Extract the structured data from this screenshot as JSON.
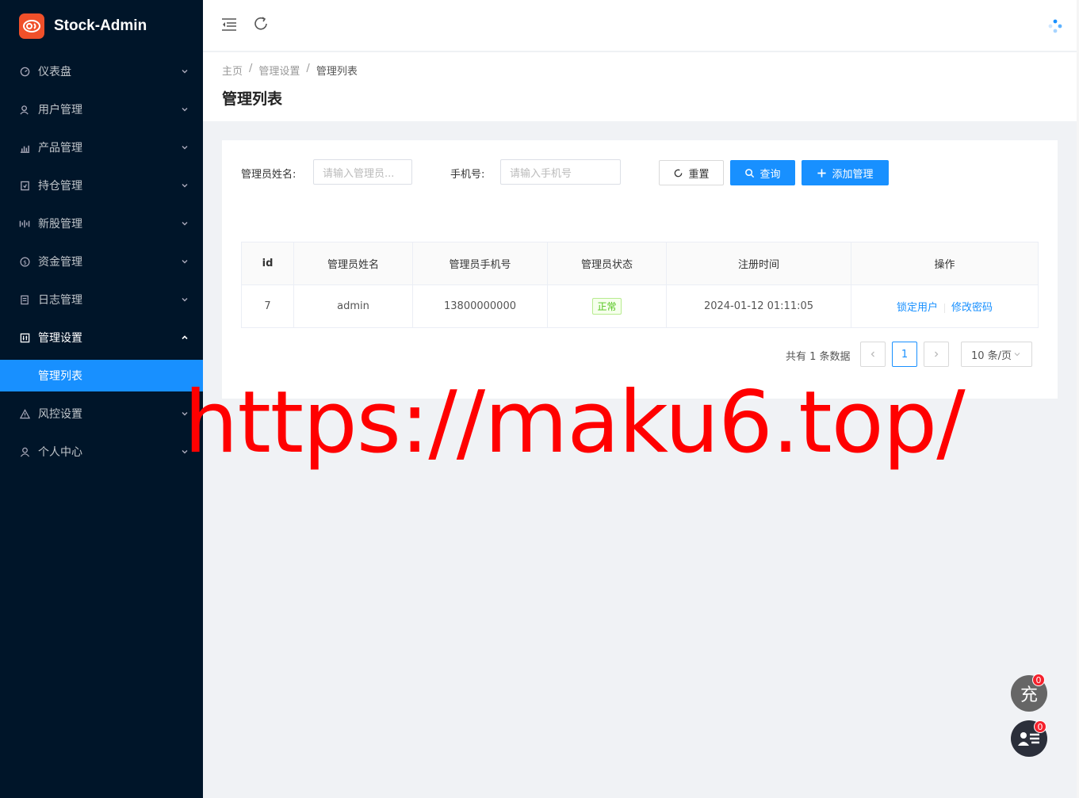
{
  "app": {
    "title": "Stock-Admin"
  },
  "sidebar": {
    "items": [
      {
        "label": "仪表盘",
        "icon": "dashboard-icon"
      },
      {
        "label": "用户管理",
        "icon": "users-icon"
      },
      {
        "label": "产品管理",
        "icon": "chart-icon"
      },
      {
        "label": "持仓管理",
        "icon": "holding-icon"
      },
      {
        "label": "新股管理",
        "icon": "ipo-icon"
      },
      {
        "label": "资金管理",
        "icon": "dollar-icon"
      },
      {
        "label": "日志管理",
        "icon": "log-icon"
      },
      {
        "label": "管理设置",
        "icon": "settings-icon"
      },
      {
        "label": "风控设置",
        "icon": "warning-icon"
      },
      {
        "label": "个人中心",
        "icon": "user-icon"
      }
    ],
    "active_sub": "管理列表"
  },
  "breadcrumb": {
    "home": "主页",
    "parent": "管理设置",
    "current": "管理列表"
  },
  "page": {
    "title": "管理列表"
  },
  "filters": {
    "name_label": "管理员姓名:",
    "name_placeholder": "请输入管理员...",
    "phone_label": "手机号:",
    "phone_placeholder": "请输入手机号",
    "reset": "重置",
    "search": "查询",
    "add": "添加管理"
  },
  "table": {
    "headers": [
      "id",
      "管理员姓名",
      "管理员手机号",
      "管理员状态",
      "注册时间",
      "操作"
    ],
    "rows": [
      {
        "id": "7",
        "name": "admin",
        "phone": "13800000000",
        "status": "正常",
        "time": "2024-01-12 01:11:05",
        "action1": "锁定用户",
        "action2": "修改密码"
      }
    ]
  },
  "pager": {
    "total": "共有 1 条数据",
    "page": "1",
    "size": "10 条/页"
  },
  "watermark": "https://maku6.top/",
  "fab": {
    "recharge": "充",
    "badge1": "0",
    "badge2": "0"
  },
  "colors": {
    "sidebar": "#001529",
    "primary": "#1890ff",
    "success": "#52c41a"
  }
}
